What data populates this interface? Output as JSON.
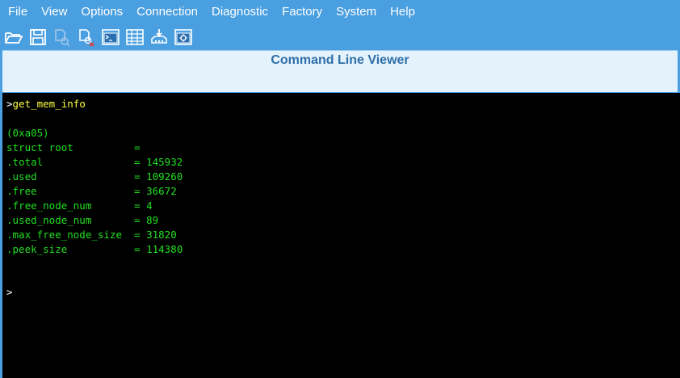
{
  "menu": [
    "File",
    "View",
    "Options",
    "Connection",
    "Diagnostic",
    "Factory",
    "System",
    "Help"
  ],
  "toolbar": [
    {
      "icon": "folder-open-icon"
    },
    {
      "icon": "save-icon"
    },
    {
      "icon": "copy-disabled-icon"
    },
    {
      "icon": "delete-disabled-icon"
    },
    {
      "icon": "command-window-icon"
    },
    {
      "icon": "table-icon"
    },
    {
      "icon": "download-device-icon"
    },
    {
      "icon": "settings-panel-icon"
    }
  ],
  "viewer": {
    "title": "Command Line Viewer"
  },
  "console": {
    "command_prompt": ">",
    "command": "get_mem_info",
    "lines": [
      "(0xa05)",
      "struct root          =",
      ".total               = 145932",
      ".used                = 109260",
      ".free                = 36672",
      ".free_node_num       = 4",
      ".used_node_num       = 89",
      ".max_free_node_size  = 31820",
      ".peek_size           = 114380"
    ],
    "final_prompt": ">"
  },
  "colors": {
    "menubar": "#4a9fe1",
    "console_bg": "#000000",
    "console_text": "#20e020",
    "command_text": "#ffff40",
    "title_text": "#2f6fa8"
  }
}
